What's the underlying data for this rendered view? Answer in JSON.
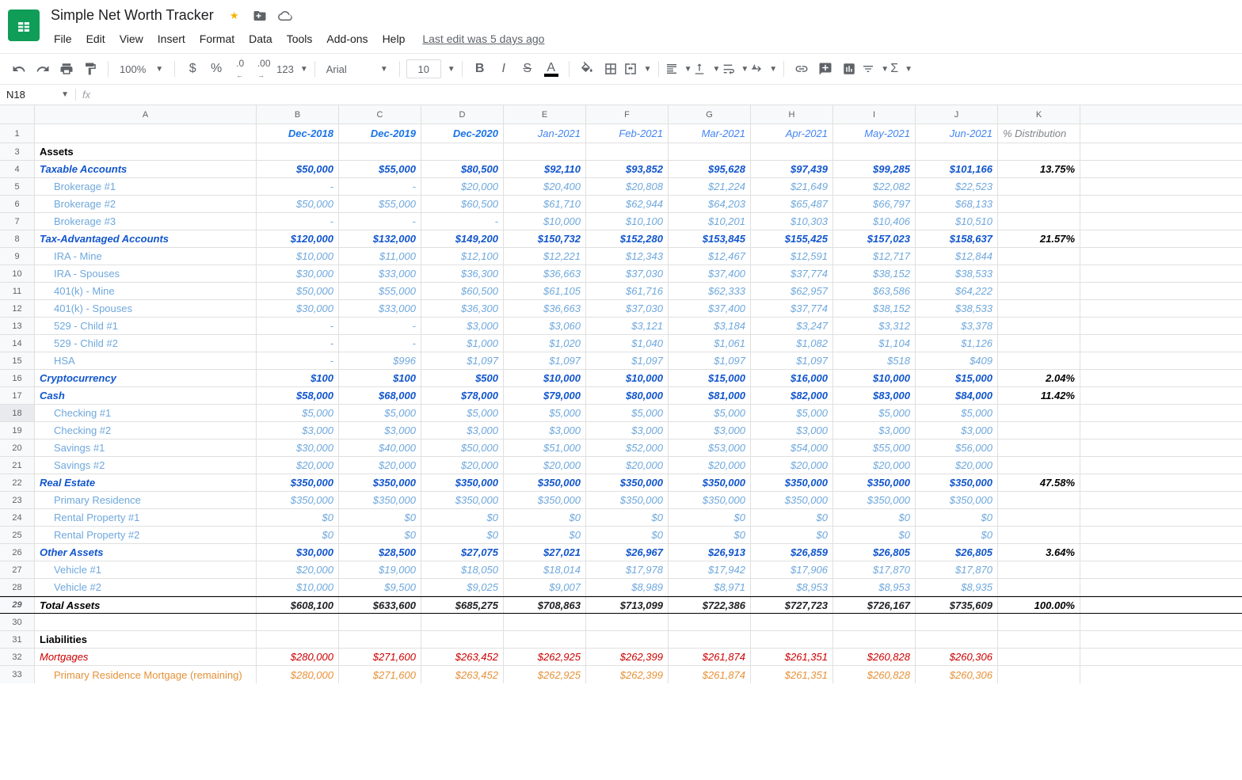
{
  "doc_title": "Simple Net Worth Tracker",
  "menubar": [
    "File",
    "Edit",
    "View",
    "Insert",
    "Format",
    "Data",
    "Tools",
    "Add-ons",
    "Help"
  ],
  "last_edit": "Last edit was 5 days ago",
  "toolbar": {
    "zoom": "100%",
    "font": "Arial",
    "size": "10",
    "fmt_num": "123"
  },
  "namebox": "N18",
  "fx": "fx",
  "formula_value": "",
  "col_letters": [
    "A",
    "B",
    "C",
    "D",
    "E",
    "F",
    "G",
    "H",
    "I",
    "J",
    "K"
  ],
  "date_headers": [
    "Dec-2018",
    "Dec-2019",
    "Dec-2020",
    "Jan-2021",
    "Feb-2021",
    "Mar-2021",
    "Apr-2021",
    "May-2021",
    "Jun-2021"
  ],
  "date_bold": [
    true,
    true,
    true,
    false,
    false,
    false,
    false,
    false,
    false
  ],
  "dist_label": "% Distribution",
  "assets_label": "Assets",
  "liabilities_label": "Liabilities",
  "total_assets_label": "Total Assets",
  "rows": [
    {
      "n": "3",
      "type": "section",
      "label": "Assets"
    },
    {
      "n": "4",
      "type": "cat",
      "label": "Taxable Accounts",
      "vals": [
        "$50,000",
        "$55,000",
        "$80,500",
        "$92,110",
        "$93,852",
        "$95,628",
        "$97,439",
        "$99,285",
        "$101,166"
      ],
      "dist": "13.75%"
    },
    {
      "n": "5",
      "type": "sub",
      "label": "Brokerage #1",
      "vals": [
        "-",
        "-",
        "$20,000",
        "$20,400",
        "$20,808",
        "$21,224",
        "$21,649",
        "$22,082",
        "$22,523"
      ]
    },
    {
      "n": "6",
      "type": "sub",
      "label": "Brokerage #2",
      "vals": [
        "$50,000",
        "$55,000",
        "$60,500",
        "$61,710",
        "$62,944",
        "$64,203",
        "$65,487",
        "$66,797",
        "$68,133"
      ]
    },
    {
      "n": "7",
      "type": "sub",
      "label": "Brokerage #3",
      "vals": [
        "-",
        "-",
        "-",
        "$10,000",
        "$10,100",
        "$10,201",
        "$10,303",
        "$10,406",
        "$10,510"
      ]
    },
    {
      "n": "8",
      "type": "cat",
      "label": "Tax-Advantaged Accounts",
      "vals": [
        "$120,000",
        "$132,000",
        "$149,200",
        "$150,732",
        "$152,280",
        "$153,845",
        "$155,425",
        "$157,023",
        "$158,637"
      ],
      "dist": "21.57%"
    },
    {
      "n": "9",
      "type": "sub",
      "label": "IRA - Mine",
      "vals": [
        "$10,000",
        "$11,000",
        "$12,100",
        "$12,221",
        "$12,343",
        "$12,467",
        "$12,591",
        "$12,717",
        "$12,844"
      ]
    },
    {
      "n": "10",
      "type": "sub",
      "label": "IRA - Spouses",
      "vals": [
        "$30,000",
        "$33,000",
        "$36,300",
        "$36,663",
        "$37,030",
        "$37,400",
        "$37,774",
        "$38,152",
        "$38,533"
      ]
    },
    {
      "n": "11",
      "type": "sub",
      "label": "401(k) - Mine",
      "vals": [
        "$50,000",
        "$55,000",
        "$60,500",
        "$61,105",
        "$61,716",
        "$62,333",
        "$62,957",
        "$63,586",
        "$64,222"
      ]
    },
    {
      "n": "12",
      "type": "sub",
      "label": "401(k) - Spouses",
      "vals": [
        "$30,000",
        "$33,000",
        "$36,300",
        "$36,663",
        "$37,030",
        "$37,400",
        "$37,774",
        "$38,152",
        "$38,533"
      ]
    },
    {
      "n": "13",
      "type": "sub",
      "label": "529 - Child #1",
      "vals": [
        "-",
        "-",
        "$3,000",
        "$3,060",
        "$3,121",
        "$3,184",
        "$3,247",
        "$3,312",
        "$3,378"
      ]
    },
    {
      "n": "14",
      "type": "sub",
      "label": "529 - Child #2",
      "vals": [
        "-",
        "-",
        "$1,000",
        "$1,020",
        "$1,040",
        "$1,061",
        "$1,082",
        "$1,104",
        "$1,126"
      ]
    },
    {
      "n": "15",
      "type": "sub",
      "label": "HSA",
      "vals": [
        "-",
        "$996",
        "$1,097",
        "$1,097",
        "$1,097",
        "$1,097",
        "$1,097",
        "$518",
        "$409"
      ]
    },
    {
      "n": "16",
      "type": "cat",
      "label": "Cryptocurrency",
      "vals": [
        "$100",
        "$100",
        "$500",
        "$10,000",
        "$10,000",
        "$15,000",
        "$16,000",
        "$10,000",
        "$15,000"
      ],
      "dist": "2.04%"
    },
    {
      "n": "17",
      "type": "cat",
      "label": "Cash",
      "vals": [
        "$58,000",
        "$68,000",
        "$78,000",
        "$79,000",
        "$80,000",
        "$81,000",
        "$82,000",
        "$83,000",
        "$84,000"
      ],
      "dist": "11.42%"
    },
    {
      "n": "18",
      "type": "sub",
      "label": "Checking #1",
      "vals": [
        "$5,000",
        "$5,000",
        "$5,000",
        "$5,000",
        "$5,000",
        "$5,000",
        "$5,000",
        "$5,000",
        "$5,000"
      ]
    },
    {
      "n": "19",
      "type": "sub",
      "label": "Checking #2",
      "vals": [
        "$3,000",
        "$3,000",
        "$3,000",
        "$3,000",
        "$3,000",
        "$3,000",
        "$3,000",
        "$3,000",
        "$3,000"
      ]
    },
    {
      "n": "20",
      "type": "sub",
      "label": "Savings #1",
      "vals": [
        "$30,000",
        "$40,000",
        "$50,000",
        "$51,000",
        "$52,000",
        "$53,000",
        "$54,000",
        "$55,000",
        "$56,000"
      ]
    },
    {
      "n": "21",
      "type": "sub",
      "label": "Savings #2",
      "vals": [
        "$20,000",
        "$20,000",
        "$20,000",
        "$20,000",
        "$20,000",
        "$20,000",
        "$20,000",
        "$20,000",
        "$20,000"
      ]
    },
    {
      "n": "22",
      "type": "cat",
      "label": "Real Estate",
      "vals": [
        "$350,000",
        "$350,000",
        "$350,000",
        "$350,000",
        "$350,000",
        "$350,000",
        "$350,000",
        "$350,000",
        "$350,000"
      ],
      "dist": "47.58%"
    },
    {
      "n": "23",
      "type": "sub",
      "label": "Primary Residence",
      "vals": [
        "$350,000",
        "$350,000",
        "$350,000",
        "$350,000",
        "$350,000",
        "$350,000",
        "$350,000",
        "$350,000",
        "$350,000"
      ]
    },
    {
      "n": "24",
      "type": "sub",
      "label": "Rental Property #1",
      "vals": [
        "$0",
        "$0",
        "$0",
        "$0",
        "$0",
        "$0",
        "$0",
        "$0",
        "$0"
      ]
    },
    {
      "n": "25",
      "type": "sub",
      "label": "Rental Property #2",
      "vals": [
        "$0",
        "$0",
        "$0",
        "$0",
        "$0",
        "$0",
        "$0",
        "$0",
        "$0"
      ]
    },
    {
      "n": "26",
      "type": "cat",
      "label": "Other Assets",
      "vals": [
        "$30,000",
        "$28,500",
        "$27,075",
        "$27,021",
        "$26,967",
        "$26,913",
        "$26,859",
        "$26,805",
        "$26,805"
      ],
      "dist": "3.64%"
    },
    {
      "n": "27",
      "type": "sub",
      "label": "Vehicle #1",
      "vals": [
        "$20,000",
        "$19,000",
        "$18,050",
        "$18,014",
        "$17,978",
        "$17,942",
        "$17,906",
        "$17,870",
        "$17,870"
      ]
    },
    {
      "n": "28",
      "type": "sub",
      "label": "Vehicle #2",
      "vals": [
        "$10,000",
        "$9,500",
        "$9,025",
        "$9,007",
        "$8,989",
        "$8,971",
        "$8,953",
        "$8,953",
        "$8,935"
      ]
    },
    {
      "n": "29",
      "type": "total",
      "label": "Total Assets",
      "vals": [
        "$608,100",
        "$633,600",
        "$685,275",
        "$708,863",
        "$713,099",
        "$722,386",
        "$727,723",
        "$726,167",
        "$735,609"
      ],
      "dist": "100.00%"
    },
    {
      "n": "30",
      "type": "blank"
    },
    {
      "n": "31",
      "type": "section",
      "label": "Liabilities"
    },
    {
      "n": "32",
      "type": "catred",
      "label": "Mortgages",
      "vals": [
        "$280,000",
        "$271,600",
        "$263,452",
        "$262,925",
        "$262,399",
        "$261,874",
        "$261,351",
        "$260,828",
        "$260,306"
      ]
    },
    {
      "n": "33",
      "type": "subred",
      "label": "Primary Residence Mortgage (remaining)",
      "vals": [
        "$280,000",
        "$271,600",
        "$263,452",
        "$262,925",
        "$262,399",
        "$261,874",
        "$261,351",
        "$260,828",
        "$260,306"
      ]
    }
  ]
}
